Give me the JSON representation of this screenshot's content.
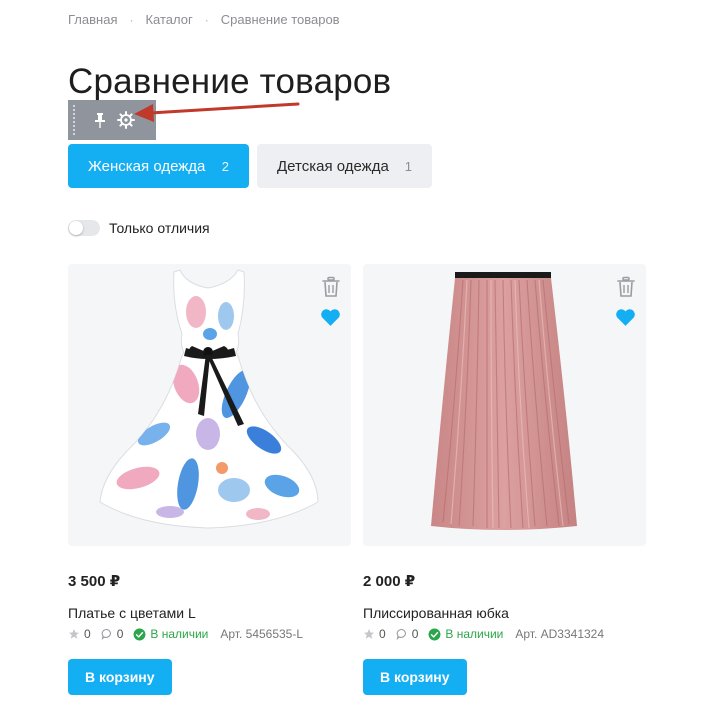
{
  "breadcrumb": {
    "items": [
      "Главная",
      "Каталог",
      "Сравнение товаров"
    ],
    "separator": "·"
  },
  "page": {
    "title": "Сравнение товаров"
  },
  "admin_toolbar": {
    "icons": [
      "grip-icon",
      "pin-icon",
      "gear-icon"
    ]
  },
  "annotation": {
    "arrow_color": "#c0392b"
  },
  "tabs": [
    {
      "label": "Женская одежда",
      "count": "2",
      "active": true
    },
    {
      "label": "Детская одежда",
      "count": "1",
      "active": false
    }
  ],
  "filters": {
    "only_differences_label": "Только отличия",
    "only_differences_on": false
  },
  "products": [
    {
      "price": "3 500 ₽",
      "name": "Платье с цветами L",
      "rating": "0",
      "reviews": "0",
      "stock": "В наличии",
      "sku": "Арт. 5456535-L",
      "cart_label": "В корзину",
      "image": "floral-dress-image"
    },
    {
      "price": "2 000 ₽",
      "name": "Плиссированная юбка",
      "rating": "0",
      "reviews": "0",
      "stock": "В наличии",
      "sku": "Арт. AD3341324",
      "cart_label": "В корзину",
      "image": "pleated-skirt-image"
    }
  ],
  "colors": {
    "accent": "#14aef3",
    "in_stock": "#2ca64a",
    "card_bg": "#f5f6f8",
    "inactive_tab": "#eeeff2"
  }
}
